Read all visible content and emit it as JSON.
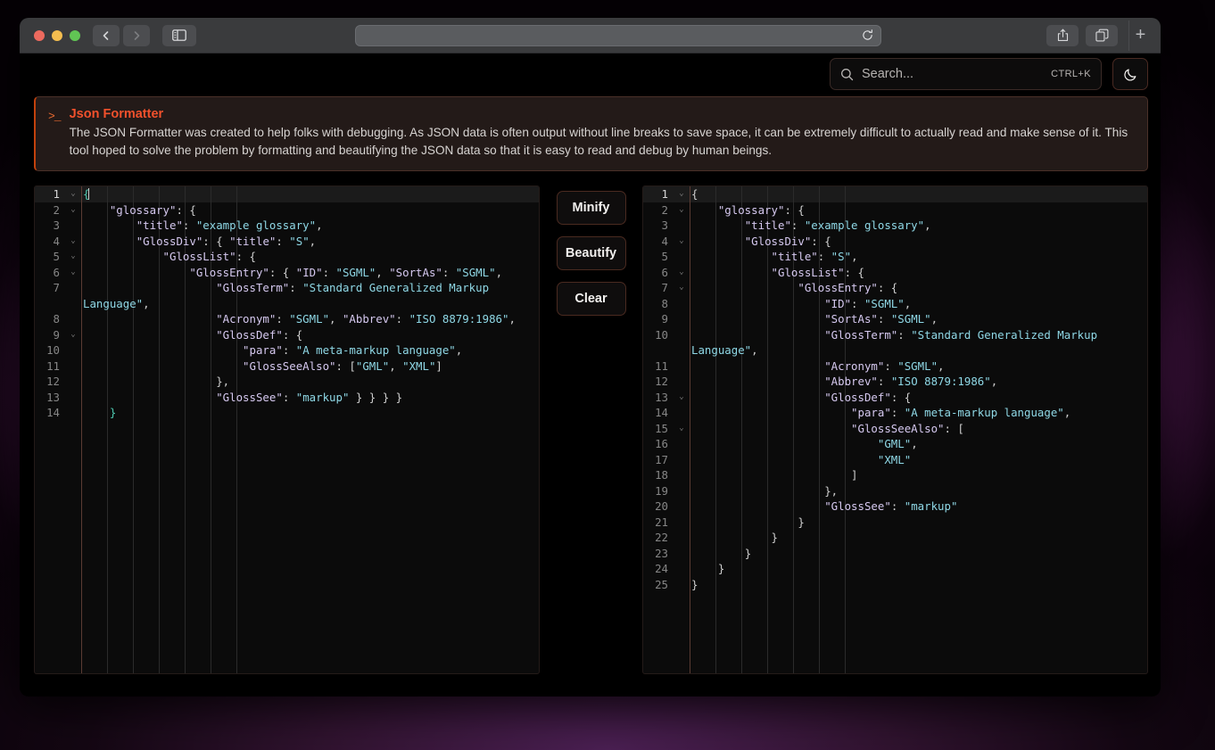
{
  "browser": {
    "back_label": "Back",
    "forward_label": "Forward",
    "sidebar_label": "Show Sidebar",
    "url_value": "",
    "url_placeholder": "",
    "reload_label": "Reload",
    "share_label": "Share",
    "tabs_label": "Show Tab Overview",
    "new_tab_label": "+"
  },
  "topbar": {
    "search_placeholder": "Search...",
    "search_value": "",
    "search_shortcut": "CTRL+K",
    "theme_toggle_icon": "moon-icon"
  },
  "banner": {
    "prompt": ">_",
    "title": "Json Formatter",
    "description": "The JSON Formatter was created to help folks with debugging. As JSON data is often output without line breaks to save space, it can be extremely difficult to actually read and make sense of it. This tool hoped to solve the problem by formatting and beautifying the JSON data so that it is easy to read and debug by human beings.",
    "accent_color": "#f2512c"
  },
  "actions": {
    "minify_label": "Minify",
    "beautify_label": "Beautify",
    "clear_label": "Clear"
  },
  "input_editor": {
    "name": "json-input-editor",
    "active_line": 1,
    "total_lines": 14,
    "lines": [
      {
        "n": "1",
        "fold": "v",
        "indent": 0,
        "active": true,
        "tokens": [
          {
            "t": "{",
            "c": "b"
          }
        ],
        "cursor": true
      },
      {
        "n": "2",
        "fold": "v",
        "indent": 1,
        "tokens": [
          {
            "t": "    \"glossary\"",
            "c": "k"
          },
          {
            "t": ": {",
            "c": "p"
          }
        ]
      },
      {
        "n": "3",
        "fold": "",
        "indent": 2,
        "tokens": [
          {
            "t": "        \"title\"",
            "c": "k"
          },
          {
            "t": ": ",
            "c": "p"
          },
          {
            "t": "\"example glossary\"",
            "c": "s"
          },
          {
            "t": ",",
            "c": "p"
          }
        ]
      },
      {
        "n": "4",
        "fold": "v",
        "indent": 2,
        "tokens": [
          {
            "t": "        \"GlossDiv\"",
            "c": "k"
          },
          {
            "t": ": { ",
            "c": "p"
          },
          {
            "t": "\"title\"",
            "c": "k"
          },
          {
            "t": ": ",
            "c": "p"
          },
          {
            "t": "\"S\"",
            "c": "s"
          },
          {
            "t": ",",
            "c": "p"
          }
        ]
      },
      {
        "n": "5",
        "fold": "v",
        "indent": 3,
        "tokens": [
          {
            "t": "            \"GlossList\"",
            "c": "k"
          },
          {
            "t": ": {",
            "c": "p"
          }
        ]
      },
      {
        "n": "6",
        "fold": "v",
        "indent": 4,
        "tokens": [
          {
            "t": "                \"GlossEntry\"",
            "c": "k"
          },
          {
            "t": ": { ",
            "c": "p"
          },
          {
            "t": "\"ID\"",
            "c": "k"
          },
          {
            "t": ": ",
            "c": "p"
          },
          {
            "t": "\"SGML\"",
            "c": "s"
          },
          {
            "t": ", ",
            "c": "p"
          },
          {
            "t": "\"SortAs\"",
            "c": "k"
          },
          {
            "t": ": ",
            "c": "p"
          },
          {
            "t": "\"SGML\"",
            "c": "s"
          },
          {
            "t": ",",
            "c": "p"
          }
        ]
      },
      {
        "n": "7",
        "fold": "",
        "indent": 5,
        "wrap": true,
        "tokens": [
          {
            "t": "                    \"GlossTerm\"",
            "c": "k"
          },
          {
            "t": ": ",
            "c": "p"
          },
          {
            "t": "\"Standard Generalized Markup Language\"",
            "c": "s"
          },
          {
            "t": ",",
            "c": "p"
          }
        ]
      },
      {
        "n": "8",
        "fold": "",
        "indent": 5,
        "tokens": [
          {
            "t": "                    \"Acronym\"",
            "c": "k"
          },
          {
            "t": ": ",
            "c": "p"
          },
          {
            "t": "\"SGML\"",
            "c": "s"
          },
          {
            "t": ", ",
            "c": "p"
          },
          {
            "t": "\"Abbrev\"",
            "c": "k"
          },
          {
            "t": ": ",
            "c": "p"
          },
          {
            "t": "\"ISO 8879:1986\"",
            "c": "s"
          },
          {
            "t": ",",
            "c": "p"
          }
        ]
      },
      {
        "n": "9",
        "fold": "v",
        "indent": 5,
        "tokens": [
          {
            "t": "                    \"GlossDef\"",
            "c": "k"
          },
          {
            "t": ": {",
            "c": "p"
          }
        ]
      },
      {
        "n": "10",
        "fold": "",
        "indent": 6,
        "tokens": [
          {
            "t": "                        \"para\"",
            "c": "k"
          },
          {
            "t": ": ",
            "c": "p"
          },
          {
            "t": "\"A meta-markup language\"",
            "c": "s"
          },
          {
            "t": ",",
            "c": "p"
          }
        ]
      },
      {
        "n": "11",
        "fold": "",
        "indent": 6,
        "tokens": [
          {
            "t": "                        \"GlossSeeAlso\"",
            "c": "k"
          },
          {
            "t": ": [",
            "c": "p"
          },
          {
            "t": "\"GML\"",
            "c": "s"
          },
          {
            "t": ", ",
            "c": "p"
          },
          {
            "t": "\"XML\"",
            "c": "s"
          },
          {
            "t": "]",
            "c": "p"
          }
        ]
      },
      {
        "n": "12",
        "fold": "",
        "indent": 5,
        "tokens": [
          {
            "t": "                    },",
            "c": "p"
          }
        ]
      },
      {
        "n": "13",
        "fold": "",
        "indent": 5,
        "tokens": [
          {
            "t": "                    \"GlossSee\"",
            "c": "k"
          },
          {
            "t": ": ",
            "c": "p"
          },
          {
            "t": "\"markup\"",
            "c": "s"
          },
          {
            "t": " } } } }",
            "c": "p"
          }
        ]
      },
      {
        "n": "14",
        "fold": "",
        "indent": 0,
        "tokens": [
          {
            "t": "    }",
            "c": "b"
          }
        ]
      }
    ]
  },
  "output_editor": {
    "name": "json-output-editor",
    "active_line": 1,
    "total_lines": 25,
    "lines": [
      {
        "n": "1",
        "fold": "v",
        "active": true,
        "tokens": [
          {
            "t": "{",
            "c": "p"
          }
        ]
      },
      {
        "n": "2",
        "fold": "v",
        "tokens": [
          {
            "t": "    \"glossary\"",
            "c": "k"
          },
          {
            "t": ": {",
            "c": "p"
          }
        ]
      },
      {
        "n": "3",
        "fold": "",
        "tokens": [
          {
            "t": "        \"title\"",
            "c": "k"
          },
          {
            "t": ": ",
            "c": "p"
          },
          {
            "t": "\"example glossary\"",
            "c": "s"
          },
          {
            "t": ",",
            "c": "p"
          }
        ]
      },
      {
        "n": "4",
        "fold": "v",
        "tokens": [
          {
            "t": "        \"GlossDiv\"",
            "c": "k"
          },
          {
            "t": ": {",
            "c": "p"
          }
        ]
      },
      {
        "n": "5",
        "fold": "",
        "tokens": [
          {
            "t": "            \"title\"",
            "c": "k"
          },
          {
            "t": ": ",
            "c": "p"
          },
          {
            "t": "\"S\"",
            "c": "s"
          },
          {
            "t": ",",
            "c": "p"
          }
        ]
      },
      {
        "n": "6",
        "fold": "v",
        "tokens": [
          {
            "t": "            \"GlossList\"",
            "c": "k"
          },
          {
            "t": ": {",
            "c": "p"
          }
        ]
      },
      {
        "n": "7",
        "fold": "v",
        "tokens": [
          {
            "t": "                \"GlossEntry\"",
            "c": "k"
          },
          {
            "t": ": {",
            "c": "p"
          }
        ]
      },
      {
        "n": "8",
        "fold": "",
        "tokens": [
          {
            "t": "                    \"ID\"",
            "c": "k"
          },
          {
            "t": ": ",
            "c": "p"
          },
          {
            "t": "\"SGML\"",
            "c": "s"
          },
          {
            "t": ",",
            "c": "p"
          }
        ]
      },
      {
        "n": "9",
        "fold": "",
        "tokens": [
          {
            "t": "                    \"SortAs\"",
            "c": "k"
          },
          {
            "t": ": ",
            "c": "p"
          },
          {
            "t": "\"SGML\"",
            "c": "s"
          },
          {
            "t": ",",
            "c": "p"
          }
        ]
      },
      {
        "n": "10",
        "fold": "",
        "wrap": true,
        "tokens": [
          {
            "t": "                    \"GlossTerm\"",
            "c": "k"
          },
          {
            "t": ": ",
            "c": "p"
          },
          {
            "t": "\"Standard Generalized Markup Language\"",
            "c": "s"
          },
          {
            "t": ",",
            "c": "p"
          }
        ]
      },
      {
        "n": "11",
        "fold": "",
        "tokens": [
          {
            "t": "                    \"Acronym\"",
            "c": "k"
          },
          {
            "t": ": ",
            "c": "p"
          },
          {
            "t": "\"SGML\"",
            "c": "s"
          },
          {
            "t": ",",
            "c": "p"
          }
        ]
      },
      {
        "n": "12",
        "fold": "",
        "tokens": [
          {
            "t": "                    \"Abbrev\"",
            "c": "k"
          },
          {
            "t": ": ",
            "c": "p"
          },
          {
            "t": "\"ISO 8879:1986\"",
            "c": "s"
          },
          {
            "t": ",",
            "c": "p"
          }
        ]
      },
      {
        "n": "13",
        "fold": "v",
        "tokens": [
          {
            "t": "                    \"GlossDef\"",
            "c": "k"
          },
          {
            "t": ": {",
            "c": "p"
          }
        ]
      },
      {
        "n": "14",
        "fold": "",
        "tokens": [
          {
            "t": "                        \"para\"",
            "c": "k"
          },
          {
            "t": ": ",
            "c": "p"
          },
          {
            "t": "\"A meta-markup language\"",
            "c": "s"
          },
          {
            "t": ",",
            "c": "p"
          }
        ]
      },
      {
        "n": "15",
        "fold": "v",
        "tokens": [
          {
            "t": "                        \"GlossSeeAlso\"",
            "c": "k"
          },
          {
            "t": ": [",
            "c": "p"
          }
        ]
      },
      {
        "n": "16",
        "fold": "",
        "tokens": [
          {
            "t": "                            ",
            "c": "p"
          },
          {
            "t": "\"GML\"",
            "c": "s"
          },
          {
            "t": ",",
            "c": "p"
          }
        ]
      },
      {
        "n": "17",
        "fold": "",
        "tokens": [
          {
            "t": "                            ",
            "c": "p"
          },
          {
            "t": "\"XML\"",
            "c": "s"
          }
        ]
      },
      {
        "n": "18",
        "fold": "",
        "tokens": [
          {
            "t": "                        ]",
            "c": "p"
          }
        ]
      },
      {
        "n": "19",
        "fold": "",
        "tokens": [
          {
            "t": "                    },",
            "c": "p"
          }
        ]
      },
      {
        "n": "20",
        "fold": "",
        "tokens": [
          {
            "t": "                    \"GlossSee\"",
            "c": "k"
          },
          {
            "t": ": ",
            "c": "p"
          },
          {
            "t": "\"markup\"",
            "c": "s"
          }
        ]
      },
      {
        "n": "21",
        "fold": "",
        "tokens": [
          {
            "t": "                }",
            "c": "p"
          }
        ]
      },
      {
        "n": "22",
        "fold": "",
        "tokens": [
          {
            "t": "            }",
            "c": "p"
          }
        ]
      },
      {
        "n": "23",
        "fold": "",
        "tokens": [
          {
            "t": "        }",
            "c": "p"
          }
        ]
      },
      {
        "n": "24",
        "fold": "",
        "tokens": [
          {
            "t": "    }",
            "c": "p"
          }
        ]
      },
      {
        "n": "25",
        "fold": "",
        "tokens": [
          {
            "t": "}",
            "c": "p"
          }
        ]
      }
    ]
  }
}
